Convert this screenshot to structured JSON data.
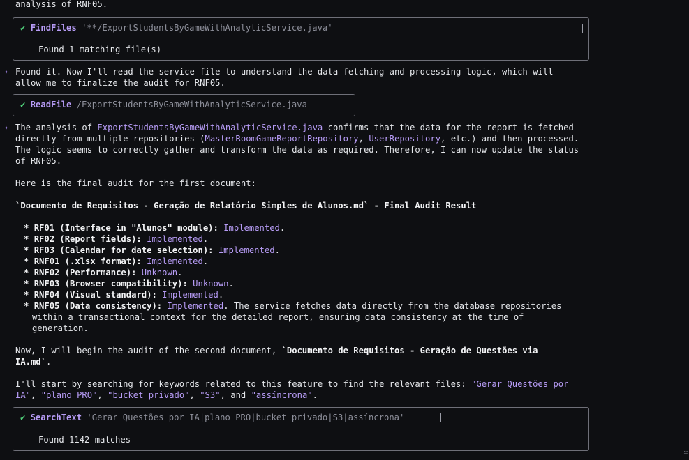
{
  "top_line": "analysis of RNF05.",
  "tool1": {
    "check": "✔",
    "name": "FindFiles",
    "arg": "'**/ExportStudentsByGameWithAnalyticService.java'",
    "result": "Found 1 matching file(s)"
  },
  "msg1": {
    "l1": "Found it. Now I'll read the service file to understand the data fetching and processing logic, which will",
    "l2": "allow me to finalize the audit for RNF05."
  },
  "tool2": {
    "check": "✔",
    "name": "ReadFile",
    "arg": "/ExportStudentsByGameWithAnalyticService.java"
  },
  "msg2": {
    "l1_a": "The analysis of ",
    "l1_b": "ExportStudentsByGameWithAnalyticService.java",
    "l1_c": " confirms that the data for the report is fetched",
    "l2_a": "directly from multiple repositories (",
    "l2_b": "MasterRoomGameReportRepository",
    "l2_c": ", ",
    "l2_d": "UserRepository",
    "l2_e": ", etc.) and then processed.",
    "l3": "The logic seems to correctly gather and transform the data as required. Therefore, I can now update the status",
    "l4": "of RNF05.",
    "l5": "Here is the final audit for the first document:",
    "heading": "`Documento de Requisitos - Geração de Relatório Simples de Alunos.md` - Final Audit Result",
    "items": [
      {
        "label": "RF01 (Interface in \"Alunos\" module):",
        "status": "Implemented",
        "tail": "."
      },
      {
        "label": "RF02 (Report fields):",
        "status": "Implemented",
        "tail": "."
      },
      {
        "label": "RF03 (Calendar for date selection):",
        "status": "Implemented",
        "tail": "."
      },
      {
        "label": "RNF01 (.xlsx format):",
        "status": "Implemented",
        "tail": "."
      },
      {
        "label": "RNF02 (Performance):",
        "status": "Unknown",
        "tail": "."
      },
      {
        "label": "RNF03 (Browser compatibility):",
        "status": "Unknown",
        "tail": "."
      },
      {
        "label": "RNF04 (Visual standard):",
        "status": "Implemented",
        "tail": "."
      },
      {
        "label": "RNF05 (Data consistency):",
        "status": "Implemented",
        "tail": ". The service fetches data directly from the database repositories"
      }
    ],
    "rnf05_cont1": "within a transactional context for the detailed report, ensuring data consistency at the time of",
    "rnf05_cont2": "generation.",
    "next_a": "Now, I will begin the audit of the second document, ",
    "next_b": "`Documento de Requisitos - Geração de Questões via",
    "next_c": "IA.md`",
    "next_d": ".",
    "search_a": "I'll start by searching for keywords related to this feature to find the relevant files: ",
    "search_k1": "\"Gerar Questões por",
    "search_k1b": "IA\"",
    "search_c1": ", ",
    "search_k2": "\"plano PRO\"",
    "search_c2": ", ",
    "search_k3": "\"bucket privado\"",
    "search_c3": ", ",
    "search_k4": "\"S3\"",
    "search_c4": ", and ",
    "search_k5": "\"assíncrona\"",
    "search_end": "."
  },
  "tool3": {
    "check": "✔",
    "name": "SearchText",
    "arg": "'Gerar Questões por IA|plano PRO|bucket privado|S3|assíncrona'",
    "result": "Found 1142 matches"
  },
  "bullet_symbol": "*",
  "sparkle_symbol": "✦",
  "scroll_icon_glyph": "⤓"
}
